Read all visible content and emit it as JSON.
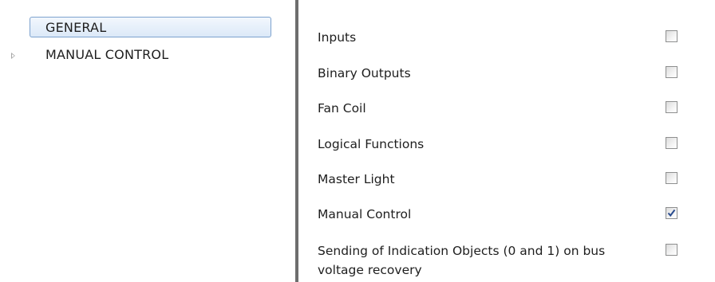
{
  "tree": {
    "items": [
      {
        "label": "GENERAL",
        "selected": true,
        "expandable": false
      },
      {
        "label": "MANUAL CONTROL",
        "selected": false,
        "expandable": true
      }
    ]
  },
  "options": [
    {
      "label": "Inputs",
      "checked": false
    },
    {
      "label": "Binary Outputs",
      "checked": false
    },
    {
      "label": "Fan Coil",
      "checked": false
    },
    {
      "label": "Logical Functions",
      "checked": false
    },
    {
      "label": "Master Light",
      "checked": false
    },
    {
      "label": "Manual Control",
      "checked": true
    },
    {
      "label": "Sending of Indication Objects (0 and 1) on bus voltage recovery",
      "checked": false
    }
  ],
  "colors": {
    "selection_border": "#7da2ce",
    "check_mark": "#2a4c8f",
    "divider": "#6e6e6e"
  }
}
